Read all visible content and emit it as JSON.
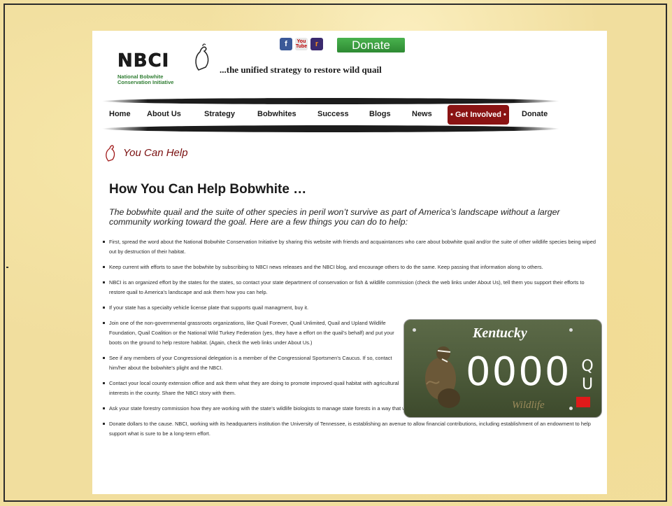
{
  "header": {
    "logo_text": "NBCI",
    "logo_subtitle_line1": "National Bobwhite",
    "logo_subtitle_line2": "Conservation Initiative",
    "tagline": "...the unified strategy to restore wild quail",
    "social": {
      "facebook": "f",
      "youtube_top": "You",
      "youtube_bottom": "Tube",
      "rss": "r"
    },
    "donate_button": "Donate"
  },
  "nav": {
    "items": [
      "Home",
      "About Us",
      "Strategy",
      "Bobwhites",
      "Success",
      "Blogs",
      "News"
    ],
    "active": "• Get Involved •",
    "last": "Donate"
  },
  "section": {
    "title": "You Can Help"
  },
  "main": {
    "heading": "How You Can Help Bobwhite …",
    "lead": "The bobwhite quail and the suite of other species in peril won’t survive as part of America’s landscape without a larger community working toward the goal. Here are a few things you can do to help:",
    "items": [
      "First, spread the word about the National Bobwhite Conservation Initiative by sharing this website with friends and acquaintances who care about bobwhite quail and/or the suite of other wildlife species being wiped out by destruction of their habitat.",
      "Keep current with efforts to save the bobwhite by subscribing to NBCI news releases and the NBCI blog, and encourage others to do the same. Keep passing that information along to others.",
      "NBCI is an organized effort by the states for the states, so contact your state department of conservation or fish & wildlife commission (check the web links under About Us), tell them you support their efforts to restore quail to America’s landscape and ask them how you can help.",
      "If your state has a specialty vehicle license plate that supports quail managment, buy it.",
      "Join one of the non-governmental grassroots organizations, like Quail Forever, Quail Unlimited, Quail and Upland Wildlife Foundation, Quail Coalition or the National Wild Turkey Federation (yes, they have a effort on the quail’s behalf) and put your boots on the ground to help restore habitat. (Again, check the web links under About Us.)",
      "See if any members of your Congressional delegation is a member of the Congressional Sportsmen’s Caucus. If so, contact him/her about the bobwhite’s plight and the NBCI.",
      "Contact your local county extension office and ask them what they are doing to promote improved quail habitat with agricultural interests in the county. Share the NBCI story with them.",
      "Ask your state forestry commission how they are working with the state’s wildlife biologists to manage state forests in a way that will help recover wild quail populations. Share the NBCI story with them.",
      "Donate dollars to the cause. NBCI, working with its headquarters institution the University of Tennessee, is establishing an avenue to allow financial contributions, including establishment of an endowment to help support what is sure to be a long-term effort."
    ]
  },
  "plate": {
    "state": "Kentucky",
    "number": "0000",
    "side_letter1": "Q",
    "side_letter2": "U",
    "bottom_text": "Wildlife"
  }
}
